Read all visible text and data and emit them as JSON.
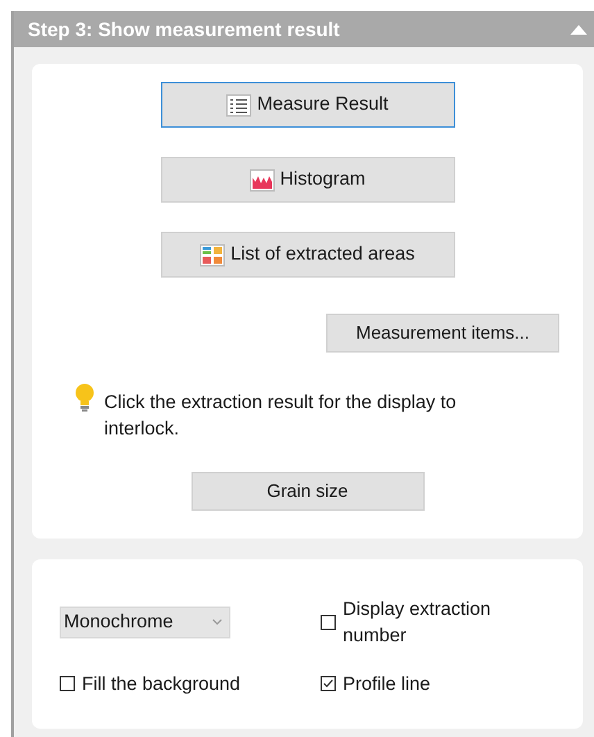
{
  "panel": {
    "title": "Step 3: Show measurement result",
    "expanded": true
  },
  "result_buttons": [
    {
      "label": "Measure Result",
      "kind": "list",
      "focused": true
    },
    {
      "label": "Histogram",
      "kind": "histogram",
      "focused": false
    },
    {
      "label": "List of extracted areas",
      "kind": "areas",
      "focused": false
    }
  ],
  "measurement_items_button": "Measurement items...",
  "tip": "Click the extraction result for the display to interlock.",
  "grain_size_button": "Grain size",
  "display": {
    "dropdown": {
      "value": "Monochrome"
    },
    "checkboxes": [
      {
        "label": "Display extraction number",
        "checked": false
      },
      {
        "label": "Fill the background",
        "checked": false
      },
      {
        "label": "Profile line",
        "checked": true
      }
    ]
  }
}
